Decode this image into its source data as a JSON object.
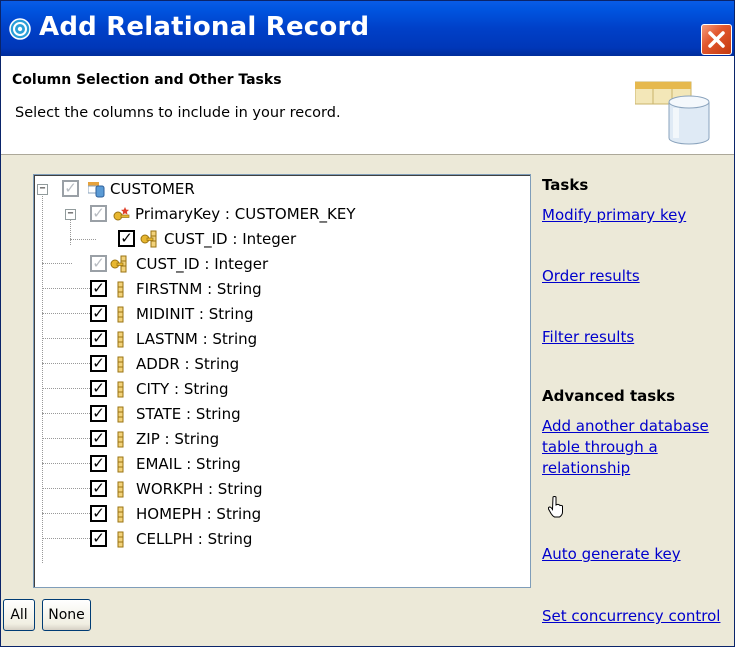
{
  "window": {
    "title": "Add Relational Record"
  },
  "header": {
    "title": "Column Selection and Other Tasks",
    "description": "Select the columns to include in your record."
  },
  "tree": {
    "root": {
      "label": "CUSTOMER",
      "checked": true,
      "icon": "table-icon"
    },
    "primary_key": {
      "label": "PrimaryKey : CUSTOMER_KEY",
      "checked": true,
      "icon": "primary-key-icon"
    },
    "pk_child": {
      "label": "CUST_ID : Integer",
      "checked": true,
      "icon": "key-column-icon"
    },
    "columns": [
      {
        "label": "CUST_ID : Integer",
        "checked": true,
        "grayed": true,
        "icon": "key-column-icon"
      },
      {
        "label": "FIRSTNM : String",
        "checked": true,
        "icon": "column-icon"
      },
      {
        "label": "MIDINIT : String",
        "checked": true,
        "icon": "column-icon"
      },
      {
        "label": "LASTNM : String",
        "checked": true,
        "icon": "column-icon"
      },
      {
        "label": "ADDR : String",
        "checked": true,
        "icon": "column-icon"
      },
      {
        "label": "CITY : String",
        "checked": true,
        "icon": "column-icon"
      },
      {
        "label": "STATE : String",
        "checked": true,
        "icon": "column-icon"
      },
      {
        "label": "ZIP : String",
        "checked": true,
        "icon": "column-icon"
      },
      {
        "label": "EMAIL : String",
        "checked": true,
        "icon": "column-icon"
      },
      {
        "label": "WORKPH : String",
        "checked": true,
        "icon": "column-icon"
      },
      {
        "label": "HOMEPH : String",
        "checked": true,
        "icon": "column-icon"
      },
      {
        "label": "CELLPH : String",
        "checked": true,
        "icon": "column-icon"
      }
    ]
  },
  "tasks": {
    "heading": "Tasks",
    "modify_primary_key": "Modify primary key",
    "order_results": "Order results",
    "filter_results": "Filter results",
    "advanced_heading": "Advanced tasks",
    "add_table_line1": "Add another database",
    "add_table_line2": "table through a",
    "add_table_line3": "relationship",
    "auto_generate_key": "Auto generate key",
    "set_concurrency": "Set concurrency control"
  },
  "buttons": {
    "all": "All",
    "none": "None"
  },
  "colors": {
    "title_bar": "#0040c8",
    "link": "#0000cc",
    "close": "#e2572e"
  }
}
